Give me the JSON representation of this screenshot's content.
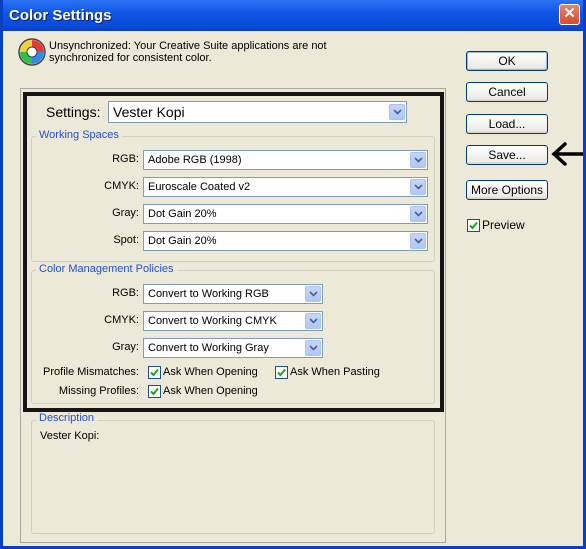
{
  "window": {
    "title": "Color Settings",
    "close_glyph": "✕"
  },
  "info": {
    "text": "Unsynchronized: Your Creative Suite applications are not synchronized for consistent color."
  },
  "buttons": {
    "ok": "OK",
    "cancel": "Cancel",
    "load": "Load...",
    "save": "Save...",
    "more_options": "More Options"
  },
  "preview": {
    "label": "Preview",
    "checked": true
  },
  "settings": {
    "label": "Settings:",
    "value": "Vester Kopi"
  },
  "working_spaces": {
    "legend": "Working Spaces",
    "rows": [
      {
        "label": "RGB:",
        "value": "Adobe RGB (1998)"
      },
      {
        "label": "CMYK:",
        "value": "Euroscale Coated v2"
      },
      {
        "label": "Gray:",
        "value": "Dot Gain 20%"
      },
      {
        "label": "Spot:",
        "value": "Dot Gain 20%"
      }
    ]
  },
  "policies": {
    "legend": "Color Management Policies",
    "rows": [
      {
        "label": "RGB:",
        "value": "Convert to Working RGB"
      },
      {
        "label": "CMYK:",
        "value": "Convert to Working CMYK"
      },
      {
        "label": "Gray:",
        "value": "Convert to Working Gray"
      }
    ],
    "profile_mismatches": {
      "label": "Profile Mismatches:",
      "ask_opening": "Ask When Opening",
      "ask_pasting": "Ask When Pasting"
    },
    "missing_profiles": {
      "label": "Missing Profiles:",
      "ask_opening": "Ask When Opening"
    }
  },
  "description": {
    "legend": "Description",
    "text": "Vester Kopi:"
  },
  "icons": {
    "sync": "color-sync-icon",
    "arrow": "left-arrow-annotation-icon",
    "dropdown": "chevron-down-icon",
    "check": "checkmark-icon"
  },
  "colors": {
    "titlebar": "#0a4bd8",
    "dialog_bg": "#ece9d8",
    "legend_text": "#2150d4",
    "highlight_border": "#161616"
  }
}
